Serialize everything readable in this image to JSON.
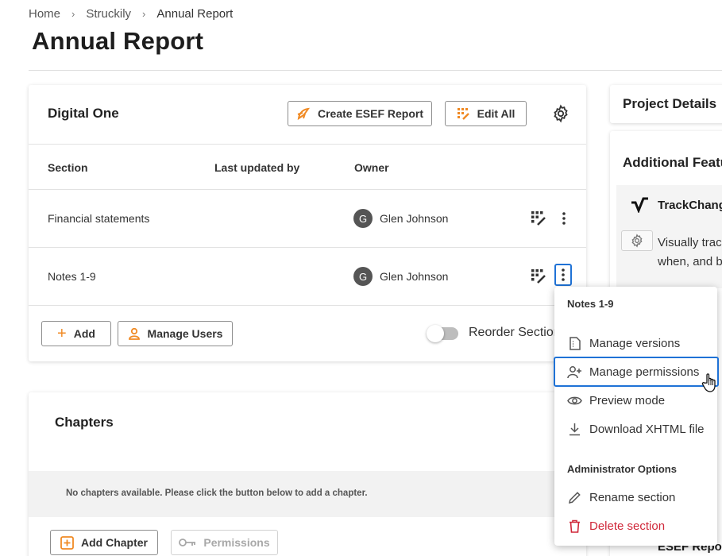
{
  "breadcrumb": {
    "items": [
      "Home",
      "Struckily",
      "Annual Report"
    ],
    "separator": "›"
  },
  "page": {
    "title": "Annual Report"
  },
  "digital_one": {
    "title": "Digital One",
    "create_esef_label": "Create ESEF Report",
    "edit_all_label": "Edit All",
    "columns": [
      "Section",
      "Last updated by",
      "Owner"
    ],
    "rows": [
      {
        "section": "Financial statements",
        "last_updated_by": "",
        "owner_initial": "G",
        "owner": "Glen Johnson"
      },
      {
        "section": "Notes 1-9",
        "last_updated_by": "",
        "owner_initial": "G",
        "owner": "Glen Johnson"
      }
    ],
    "add_label": "Add",
    "manage_users_label": "Manage Users",
    "reorder_label": "Reorder Sections",
    "reorder_on": false
  },
  "chapters": {
    "title": "Chapters",
    "empty_message": "No chapters available. Please click the button below to add a chapter.",
    "add_chapter_label": "Add Chapter",
    "permissions_label": "Permissions"
  },
  "right_panel": {
    "project_details_title": "Project Details",
    "additional_features_title": "Additional Features",
    "trackchanges_name": "TrackChanges",
    "trackchanges_desc_line1": "Visually track",
    "trackchanges_desc_line2": "when, and by",
    "esef_peek": "ESEF Report"
  },
  "context_menu": {
    "header": "Notes 1-9",
    "items": [
      {
        "label": "Manage versions",
        "icon": "versions-icon"
      },
      {
        "label": "Manage permissions",
        "icon": "add-user-icon",
        "highlighted": true
      },
      {
        "label": "Preview mode",
        "icon": "eye-icon"
      },
      {
        "label": "Download XHTML file",
        "icon": "download-icon"
      }
    ],
    "admin_header": "Administrator Options",
    "admin_items": [
      {
        "label": "Rename section",
        "icon": "pencil-icon"
      },
      {
        "label": "Delete section",
        "icon": "trash-icon",
        "danger": true
      }
    ]
  },
  "colors": {
    "accent_orange": "#f08a24",
    "focus_blue": "#1f72d6",
    "danger_red": "#d0283a"
  }
}
